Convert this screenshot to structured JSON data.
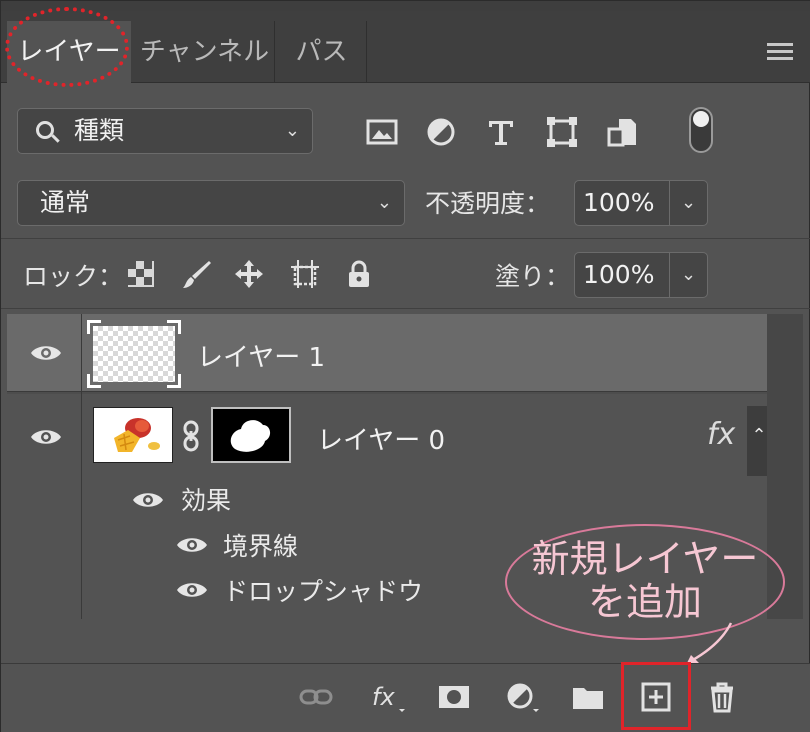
{
  "tabs": [
    {
      "label": "レイヤー",
      "active": true
    },
    {
      "label": "チャンネル",
      "active": false
    },
    {
      "label": "パス",
      "active": false
    }
  ],
  "filter": {
    "label": "種類",
    "icon": "search-icon"
  },
  "filter_icons": [
    "image-filter-icon",
    "adjustment-filter-icon",
    "type-filter-icon",
    "shape-filter-icon",
    "smart-object-filter-icon"
  ],
  "blend_mode": "通常",
  "opacity": {
    "label": "不透明度：",
    "value": "100%"
  },
  "lock": {
    "label": "ロック：",
    "icons": [
      "lock-transparent-pixels-icon",
      "lock-image-pixels-icon",
      "lock-position-icon",
      "lock-artboard-icon",
      "lock-all-icon"
    ]
  },
  "fill": {
    "label": "塗り：",
    "value": "100%"
  },
  "layers": [
    {
      "name": "レイヤー 1",
      "selected": true
    },
    {
      "name": "レイヤー 0",
      "selected": false,
      "fx": "fx",
      "effects_label": "効果",
      "effects": [
        "境界線",
        "ドロップシャドウ"
      ]
    }
  ],
  "bottom_icons": [
    "link-layers-icon",
    "fx-icon",
    "add-mask-icon",
    "adjustment-layer-icon",
    "group-folder-icon",
    "new-layer-icon",
    "trash-icon"
  ],
  "annotation": {
    "line1": "新規レイヤー",
    "line2": "を追加"
  },
  "colors": {
    "panel": "#535353",
    "tabbar": "#3f3f3f",
    "selected_row": "#6a6a6a",
    "annotation_red": "#e0242a",
    "callout_pink": "#f6c7d3"
  }
}
